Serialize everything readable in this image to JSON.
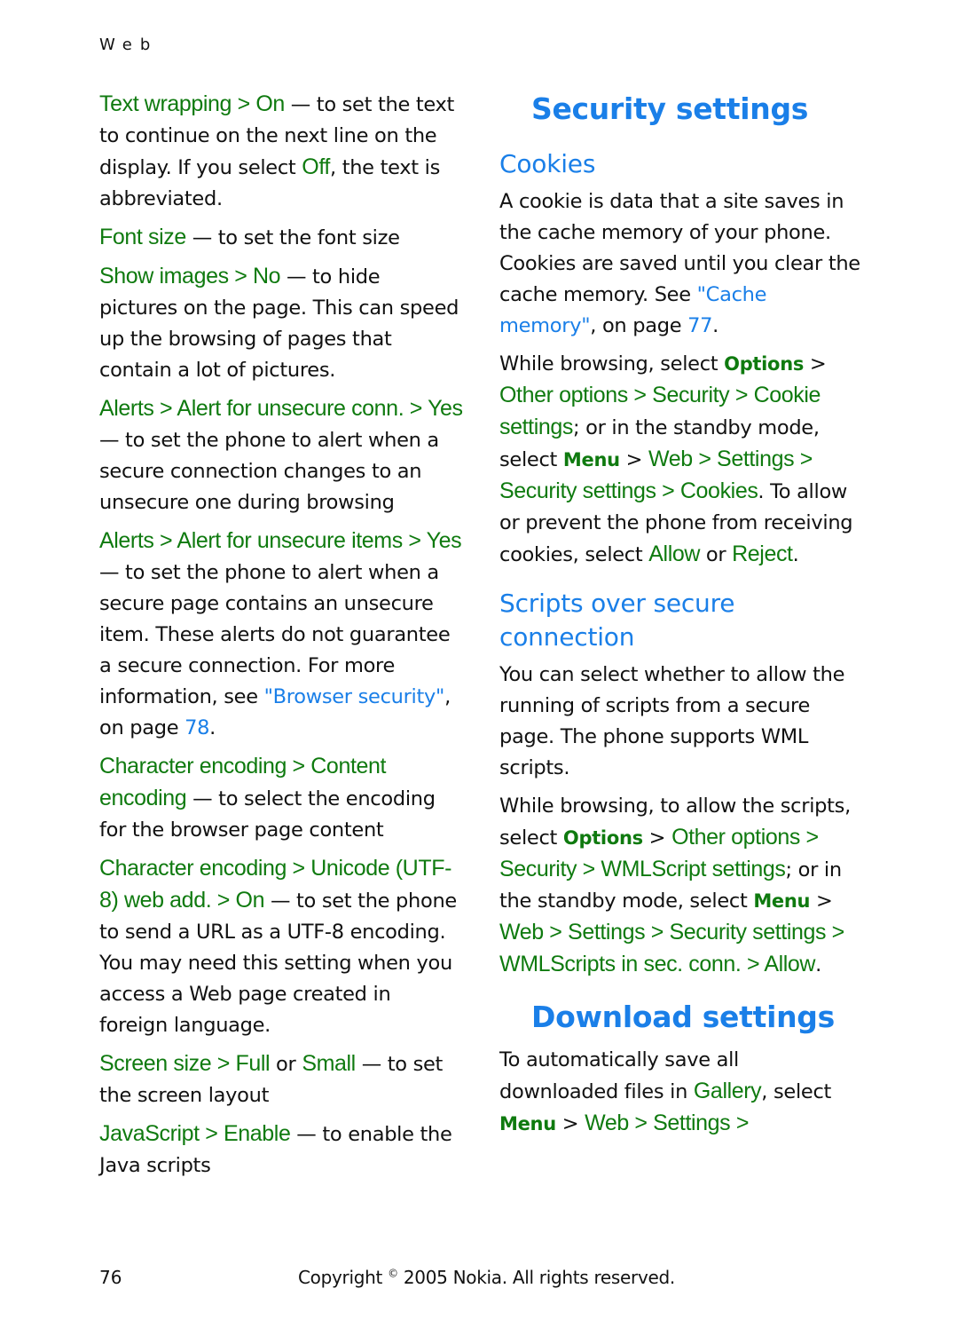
{
  "running_head": "Web",
  "left_column": {
    "items": [
      {
        "parts": [
          {
            "t": "Text wrapping > On",
            "s": "g"
          },
          {
            "t": " — to set the text to continue on the next line on the display. If you select ",
            "s": ""
          },
          {
            "t": "Off",
            "s": "g"
          },
          {
            "t": ", the text is abbreviated.",
            "s": ""
          }
        ]
      },
      {
        "parts": [
          {
            "t": "Font size",
            "s": "g"
          },
          {
            "t": " — to set the font size",
            "s": ""
          }
        ]
      },
      {
        "parts": [
          {
            "t": "Show images > No",
            "s": "g"
          },
          {
            "t": " — to hide pictures on the page. This can speed up the browsing of pages that contain a lot of pictures.",
            "s": ""
          }
        ]
      },
      {
        "parts": [
          {
            "t": "Alerts > Alert for unsecure conn. > Yes",
            "s": "g"
          },
          {
            "t": " — to set the phone to alert when a secure connection changes to an unsecure one during browsing",
            "s": ""
          }
        ]
      },
      {
        "parts": [
          {
            "t": "Alerts > Alert for unsecure items > Yes",
            "s": "g"
          },
          {
            "t": " — to set the phone to alert when a secure page contains an unsecure item. These alerts do not guarantee a secure connection. For more information, see ",
            "s": ""
          },
          {
            "t": "\"Browser security\"",
            "s": "lnk"
          },
          {
            "t": ", on page ",
            "s": ""
          },
          {
            "t": "78",
            "s": "lnk"
          },
          {
            "t": ".",
            "s": ""
          }
        ]
      },
      {
        "parts": [
          {
            "t": "Character encoding > Content encoding",
            "s": "g"
          },
          {
            "t": " — to select the encoding for the browser page content",
            "s": ""
          }
        ]
      },
      {
        "parts": [
          {
            "t": "Character encoding > Unicode (UTF-8) web add. > On",
            "s": "g"
          },
          {
            "t": " — to set the phone to send a URL as a UTF-8 encoding. You may need this setting when you access a Web page created in foreign language.",
            "s": ""
          }
        ]
      },
      {
        "parts": [
          {
            "t": "Screen size > Full",
            "s": "g"
          },
          {
            "t": " or ",
            "s": ""
          },
          {
            "t": "Small",
            "s": "g"
          },
          {
            "t": " — to set the screen layout",
            "s": ""
          }
        ]
      },
      {
        "parts": [
          {
            "t": "JavaScript > Enable",
            "s": "g"
          },
          {
            "t": " — to enable the Java scripts",
            "s": ""
          }
        ]
      }
    ]
  },
  "right_column": {
    "security_heading": "Security settings",
    "cookies_heading": "Cookies",
    "cookies_p1": [
      {
        "t": "A cookie is data that a site saves in the cache memory of your phone. Cookies are saved until you clear the cache memory. See ",
        "s": ""
      },
      {
        "t": "\"Cache memory\"",
        "s": "lnk"
      },
      {
        "t": ", on page ",
        "s": ""
      },
      {
        "t": "77",
        "s": "lnk"
      },
      {
        "t": ".",
        "s": ""
      }
    ],
    "cookies_p2": [
      {
        "t": "While browsing, select ",
        "s": ""
      },
      {
        "t": "Options",
        "s": "gb"
      },
      {
        "t": " > ",
        "s": ""
      },
      {
        "t": "Other options > Security > Cookie settings",
        "s": "g"
      },
      {
        "t": "; or in the standby mode, select ",
        "s": ""
      },
      {
        "t": "Menu",
        "s": "gb"
      },
      {
        "t": " > ",
        "s": ""
      },
      {
        "t": "Web > Settings > Security settings > Cookies",
        "s": "g"
      },
      {
        "t": ". To allow or prevent the phone from receiving cookies, select ",
        "s": ""
      },
      {
        "t": "Allow",
        "s": "g"
      },
      {
        "t": " or ",
        "s": ""
      },
      {
        "t": "Reject",
        "s": "g"
      },
      {
        "t": ".",
        "s": ""
      }
    ],
    "scripts_heading": "Scripts over secure connection",
    "scripts_p1": [
      {
        "t": "You can select whether to allow the running of scripts from a secure page. The phone supports WML scripts.",
        "s": ""
      }
    ],
    "scripts_p2": [
      {
        "t": "While browsing, to allow the scripts, select ",
        "s": ""
      },
      {
        "t": "Options",
        "s": "gb"
      },
      {
        "t": " > ",
        "s": ""
      },
      {
        "t": "Other options > Security > WMLScript settings",
        "s": "g"
      },
      {
        "t": "; or in the standby mode, select ",
        "s": ""
      },
      {
        "t": "Menu",
        "s": "gb"
      },
      {
        "t": " > ",
        "s": ""
      },
      {
        "t": "Web > Settings > Security settings > WMLScripts in sec. conn. > Allow",
        "s": "g"
      },
      {
        "t": ".",
        "s": ""
      }
    ],
    "download_heading": "Download settings",
    "download_p1": [
      {
        "t": "To automatically save all downloaded files in ",
        "s": ""
      },
      {
        "t": "Gallery",
        "s": "g"
      },
      {
        "t": ", select ",
        "s": ""
      },
      {
        "t": "Menu",
        "s": "gb"
      },
      {
        "t": " > ",
        "s": ""
      },
      {
        "t": "Web > Settings >",
        "s": "g"
      }
    ]
  },
  "footer": {
    "page_number": "76",
    "copyright_prefix": "Copyright ",
    "copyright_symbol": "©",
    "copyright_suffix": " 2005 Nokia. All rights reserved."
  },
  "colors": {
    "heading_blue": "#1a7fe8",
    "menu_green": "#0f7a0f",
    "body_text": "#111111"
  }
}
